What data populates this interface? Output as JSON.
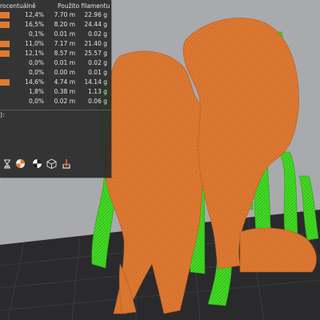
{
  "legend": {
    "headers": {
      "percent": "rocentuálně",
      "filament": "Použito filamentu"
    },
    "rows": [
      {
        "swatch": true,
        "percent": "12,4%",
        "length": "7.70 m",
        "weight": "22.96 g"
      },
      {
        "swatch": true,
        "percent": "16,5%",
        "length": "8.20 m",
        "weight": "24.44 g"
      },
      {
        "swatch": false,
        "percent": "0,1%",
        "length": "0.01 m",
        "weight": "0.02 g"
      },
      {
        "swatch": true,
        "percent": "11,0%",
        "length": "7.17 m",
        "weight": "21.40 g"
      },
      {
        "swatch": true,
        "percent": "12,1%",
        "length": "8.57 m",
        "weight": "25.57 g"
      },
      {
        "swatch": false,
        "percent": "0,0%",
        "length": "0.01 m",
        "weight": "0.02 g"
      },
      {
        "swatch": false,
        "percent": "0,0%",
        "length": "0.00 m",
        "weight": "0.01 g"
      },
      {
        "swatch": true,
        "percent": "14,6%",
        "length": "4.74 m",
        "weight": "14.14 g"
      },
      {
        "swatch": false,
        "percent": "1,8%",
        "length": "0.38 m",
        "weight": "1.13 g"
      },
      {
        "swatch": false,
        "percent": "0,0%",
        "length": "0.02 m",
        "weight": "0.06 g"
      }
    ],
    "label": "):",
    "swatch_color": "#e07a32"
  },
  "toolbar": {
    "icons": [
      "hourglass-icon",
      "color-print-icon",
      "settings-icon",
      "cube-view-icon",
      "export-icon"
    ]
  },
  "scene": {
    "background_color": "#a9aaad",
    "bed_color": "#2a2a2c",
    "infill_color": "#e07a32",
    "support_color": "#3ed61e"
  }
}
